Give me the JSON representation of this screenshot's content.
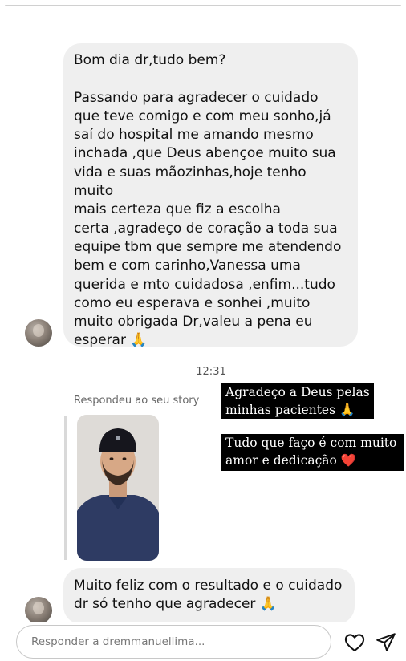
{
  "message1": "Bom dia dr,tudo bem?\n\nPassando para agradecer o cuidado\nque teve comigo e com meu sonho,já\nsaí do hospital me amando mesmo\ninchada ,que Deus abençoe muito sua\nvida e suas mãozinhas,hoje tenho muito\nmais certeza que fiz a escolha\ncerta ,agradeço de coração a toda sua\nequipe tbm que sempre me atendendo\nbem e com carinho,Vanessa uma\nquerida e mto cuidadosa ,enfim...tudo\ncomo eu esperava e sonhei ,muito\nmuito obrigada Dr,valeu a pena eu\nesperar 🙏",
  "timestamp": "12:31",
  "story_reply_label": "Respondeu ao seu story",
  "captions": [
    "Agradeço a Deus pelas\nminhas pacientes 🙏",
    "Tudo que faço é com muito\namor e dedicação ❤️"
  ],
  "message2": "Muito feliz com o resultado e o cuidado\ndr só tenho que agradecer 🙏",
  "reply_placeholder": "Responder a dremmanuellima...",
  "icons": [
    "heart-icon",
    "send-icon"
  ],
  "colors": {
    "bubble": "#efefef",
    "caption_bg": "#000000",
    "heart": "#e0182d"
  }
}
